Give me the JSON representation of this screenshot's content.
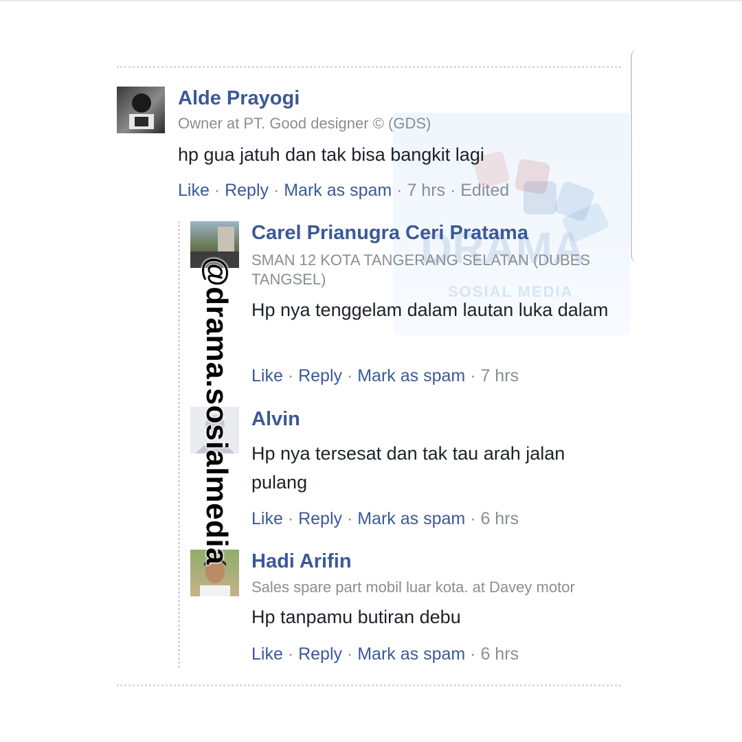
{
  "watermark": {
    "handle": "@drama.sosialmedia",
    "logo_text": "DRAMA",
    "logo_sub": "SOSIAL MEDIA"
  },
  "comments": [
    {
      "name": "Alde Prayogi",
      "subtitle": "Owner at PT. Good designer © (GDS)",
      "text": "hp gua jatuh dan tak bisa bangkit lagi",
      "actions": {
        "like": "Like",
        "reply": "Reply",
        "spam": "Mark as spam",
        "time": "7 hrs",
        "edited": "Edited"
      }
    },
    {
      "name": "Carel Prianugra Ceri Pratama",
      "subtitle": "SMAN 12 KOTA TANGERANG SELATAN (DUBES TANGSEL)",
      "text": "Hp nya tenggelam dalam lautan luka dalam",
      "actions": {
        "like": "Like",
        "reply": "Reply",
        "spam": "Mark as spam",
        "time": "7 hrs"
      }
    },
    {
      "name": "Alvin",
      "subtitle": "",
      "text": "Hp nya tersesat dan tak tau arah jalan pulang",
      "actions": {
        "like": "Like",
        "reply": "Reply",
        "spam": "Mark as spam",
        "time": "6 hrs"
      }
    },
    {
      "name": "Hadi Arifin",
      "subtitle": "Sales spare part mobil luar kota. at Davey motor",
      "text": "Hp tanpamu butiran debu",
      "actions": {
        "like": "Like",
        "reply": "Reply",
        "spam": "Mark as spam",
        "time": "6 hrs"
      }
    }
  ]
}
